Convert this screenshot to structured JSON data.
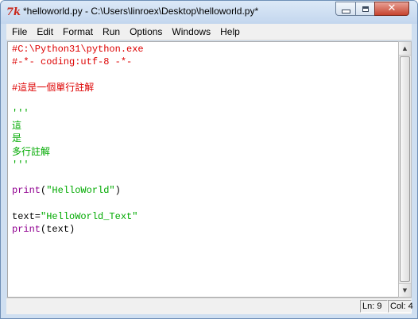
{
  "window": {
    "title": "*helloworld.py - C:\\Users\\linroex\\Desktop\\helloworld.py*",
    "icon_glyph": "7k",
    "icon_name": "idle-app-icon",
    "controls": {
      "minimize": "minimize",
      "maximize": "maximize",
      "close": "✕"
    }
  },
  "menu": [
    "File",
    "Edit",
    "Format",
    "Run",
    "Options",
    "Windows",
    "Help"
  ],
  "editor": {
    "lines": [
      {
        "text": "#C:\\Python31\\python.exe",
        "kind": "comment"
      },
      {
        "text": "#-*- coding:utf-8 -*-",
        "kind": "comment"
      },
      {
        "text": "",
        "kind": "default"
      },
      {
        "text": "#這是一個單行註解",
        "kind": "comment"
      },
      {
        "text": "",
        "kind": "default"
      },
      {
        "text": "'''",
        "kind": "string"
      },
      {
        "text": "這",
        "kind": "string"
      },
      {
        "text": "是",
        "kind": "string"
      },
      {
        "text": "多行註解",
        "kind": "string"
      },
      {
        "text": "'''",
        "kind": "string"
      },
      {
        "text": "",
        "kind": "default"
      },
      {
        "segments": [
          {
            "text": "print",
            "kind": "builtin"
          },
          {
            "text": "(",
            "kind": "default"
          },
          {
            "text": "\"HelloWorld\"",
            "kind": "string"
          },
          {
            "text": ")",
            "kind": "default"
          }
        ]
      },
      {
        "text": "",
        "kind": "default"
      },
      {
        "segments": [
          {
            "text": "text=",
            "kind": "default"
          },
          {
            "text": "\"HelloWorld_Text\"",
            "kind": "string"
          }
        ]
      },
      {
        "segments": [
          {
            "text": "print",
            "kind": "builtin"
          },
          {
            "text": "(text)",
            "kind": "default"
          }
        ]
      }
    ],
    "colors": {
      "comment": "#dd0000",
      "string": "#00aa00",
      "builtin": "#900090",
      "default": "#000000"
    }
  },
  "status": {
    "line": "Ln: 9",
    "column": "Col: 4"
  }
}
